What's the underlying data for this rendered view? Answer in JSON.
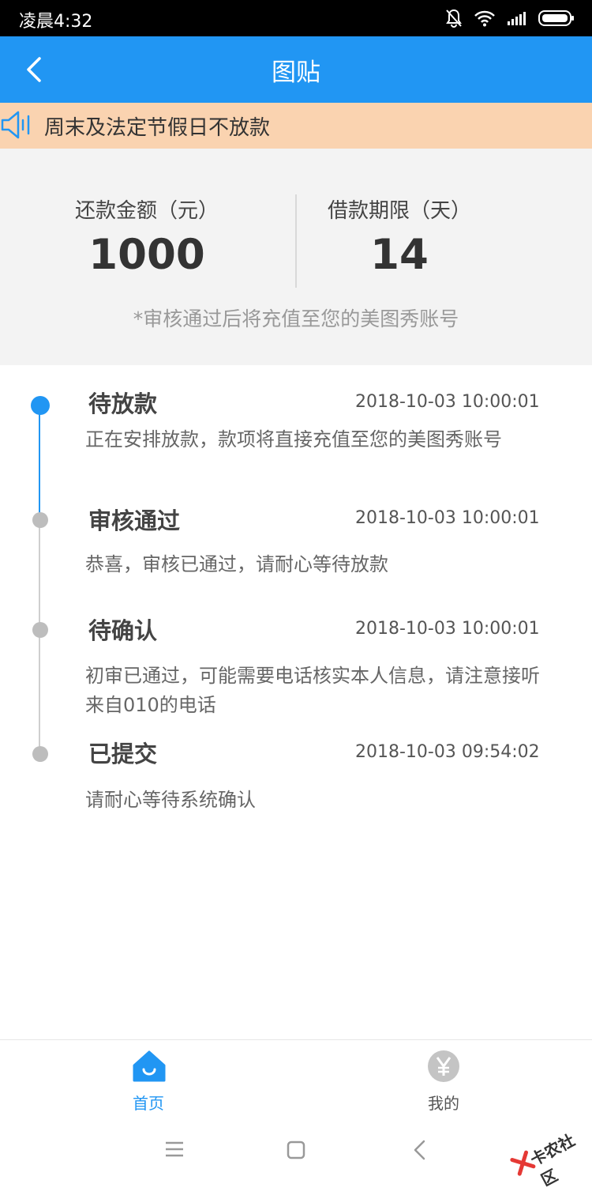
{
  "status_bar": {
    "time": "凌晨4:32"
  },
  "header": {
    "title": "图贴"
  },
  "notice": {
    "text": "周末及法定节假日不放款"
  },
  "summary": {
    "amount_label": "还款金额（元）",
    "amount_value": "1000",
    "term_label": "借款期限（天）",
    "term_value": "14",
    "note": "*审核通过后将充值至您的美图秀账号"
  },
  "timeline": [
    {
      "title": "待放款",
      "time": "2018-10-03 10:00:01",
      "desc": "正在安排放款，款项将直接充值至您的美图秀账号",
      "active": true
    },
    {
      "title": "审核通过",
      "time": "2018-10-03 10:00:01",
      "desc": "恭喜，审核已通过，请耐心等待放款",
      "active": false
    },
    {
      "title": "待确认",
      "time": "2018-10-03 10:00:01",
      "desc": "初审已通过，可能需要电话核实本人信息，请注意接听来自010的电话",
      "active": false
    },
    {
      "title": "已提交",
      "time": "2018-10-03 09:54:02",
      "desc": "请耐心等待系统确认",
      "active": false
    }
  ],
  "bottom_nav": [
    {
      "label": "首页",
      "icon": "home-icon",
      "active": true
    },
    {
      "label": "我的",
      "icon": "yen-icon",
      "active": false
    }
  ],
  "watermark": {
    "text": "卡农社区"
  },
  "colors": {
    "primary": "#2196f3",
    "notice_bg": "#fad3b0",
    "inactive": "#bdbdbd"
  }
}
